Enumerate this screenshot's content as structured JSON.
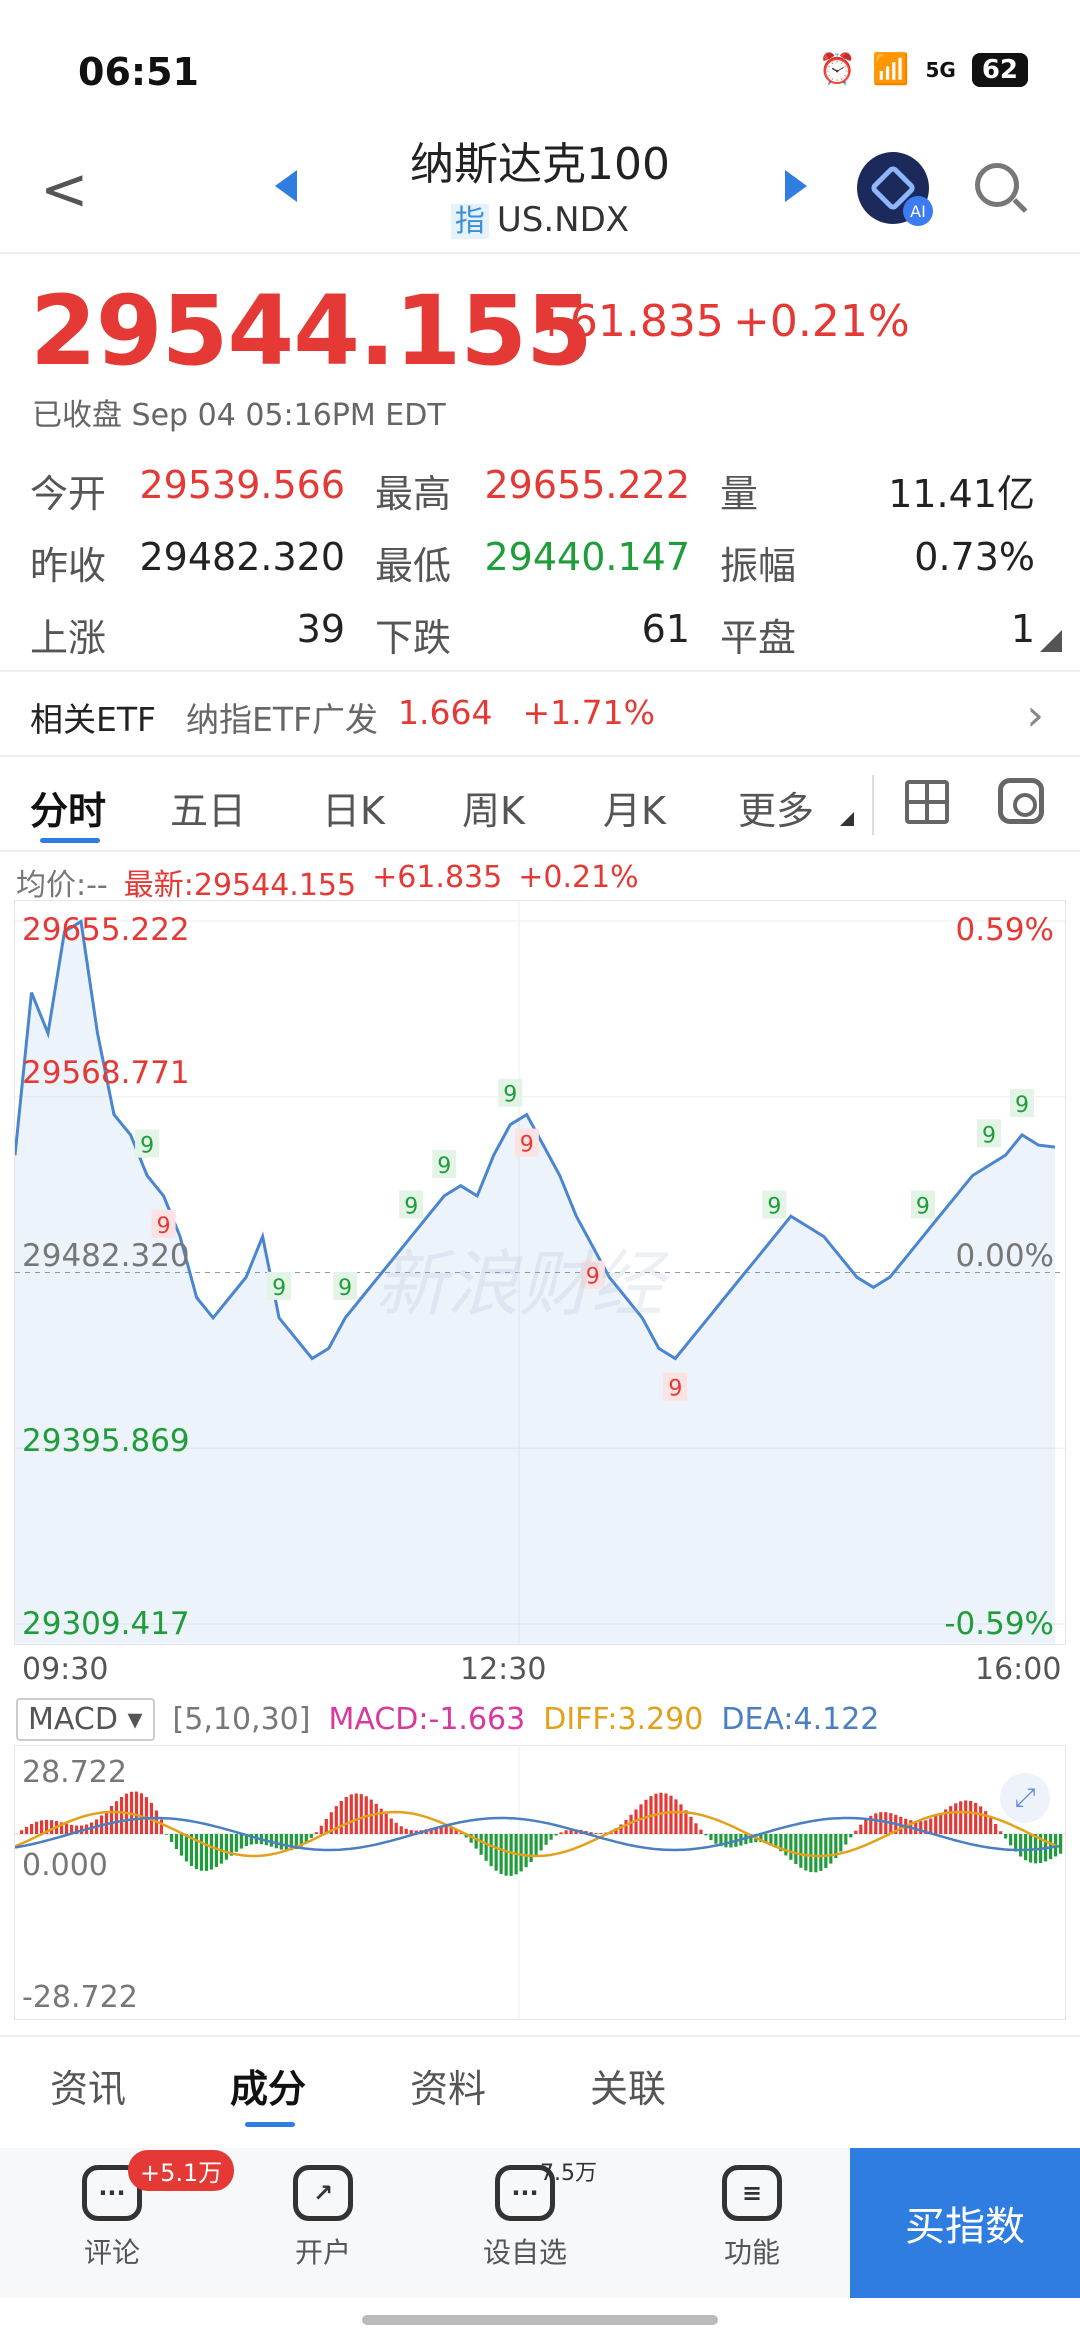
{
  "status": {
    "time": "06:51",
    "network": "5G",
    "battery": "62"
  },
  "header": {
    "title": "纳斯达克100",
    "tag": "指",
    "code": "US.NDX"
  },
  "quote": {
    "price": "29544.155",
    "change": "+61.835",
    "pct": "+0.21%",
    "status": "已收盘 Sep 04 05:16PM EDT"
  },
  "stats": [
    {
      "label": "今开",
      "value": "29539.566",
      "color": "red"
    },
    {
      "label": "最高",
      "value": "29655.222",
      "color": "red"
    },
    {
      "label": "量",
      "value": "11.41亿",
      "color": "dark"
    },
    {
      "label": "昨收",
      "value": "29482.320",
      "color": "dark"
    },
    {
      "label": "最低",
      "value": "29440.147",
      "color": "green"
    },
    {
      "label": "振幅",
      "value": "0.73%",
      "color": "dark"
    },
    {
      "label": "上涨",
      "value": "39",
      "color": "dark"
    },
    {
      "label": "下跌",
      "value": "61",
      "color": "dark"
    },
    {
      "label": "平盘",
      "value": "1",
      "color": "dark"
    }
  ],
  "etf": {
    "label": "相关ETF",
    "name": "纳指ETF广发",
    "price": "1.664",
    "pct": "+1.71%"
  },
  "tabs": [
    "分时",
    "五日",
    "日K",
    "周K",
    "月K",
    "更多"
  ],
  "chart_legend": {
    "avg": "均价:--",
    "latest": "最新:29544.155",
    "change": "+61.835",
    "pct": "+0.21%"
  },
  "chart_data": {
    "type": "line",
    "title": "",
    "x_ticks": [
      "09:30",
      "12:30",
      "16:00"
    ],
    "y_ticks": [
      "29655.222",
      "29568.771",
      "29482.320",
      "29395.869",
      "29309.417"
    ],
    "pct_ticks": [
      "0.59%",
      "0.00%",
      "-0.59%"
    ],
    "ylim": [
      29309.417,
      29655.222
    ],
    "prev_close": 29482.32,
    "watermark": "新浪财经",
    "series": [
      {
        "values": [
          29540,
          29620,
          29600,
          29650,
          29655,
          29600,
          29560,
          29550,
          29530,
          29520,
          29500,
          29470,
          29460,
          29470,
          29480,
          29500,
          29460,
          29450,
          29440,
          29445,
          29460,
          29470,
          29480,
          29490,
          29500,
          29510,
          29520,
          29525,
          29520,
          29540,
          29555,
          29560,
          29545,
          29530,
          29510,
          29495,
          29480,
          29470,
          29460,
          29445,
          29440,
          29450,
          29460,
          29470,
          29480,
          29490,
          29500,
          29510,
          29505,
          29500,
          29490,
          29480,
          29475,
          29480,
          29490,
          29500,
          29510,
          29520,
          29530,
          29535,
          29540,
          29550,
          29545,
          29544
        ]
      }
    ],
    "markers": [
      "9",
      "9",
      "9",
      "9",
      "9",
      "9",
      "9",
      "9",
      "9",
      "9",
      "9",
      "9",
      "9",
      "9"
    ]
  },
  "macd": {
    "selector": "MACD",
    "params": "[5,10,30]",
    "macd": "MACD:-1.663",
    "diff": "DIFF:3.290",
    "dea": "DEA:4.122",
    "ymax": "28.722",
    "ymid": "0.000",
    "ymin": "-28.722"
  },
  "section_tabs": [
    "资讯",
    "成分",
    "资料",
    "关联"
  ],
  "bottom": {
    "comment": "评论",
    "comment_badge": "+5.1万",
    "open": "开户",
    "watch": "设自选",
    "watch_count": "7.5万",
    "func": "功能",
    "buy": "买指数"
  }
}
